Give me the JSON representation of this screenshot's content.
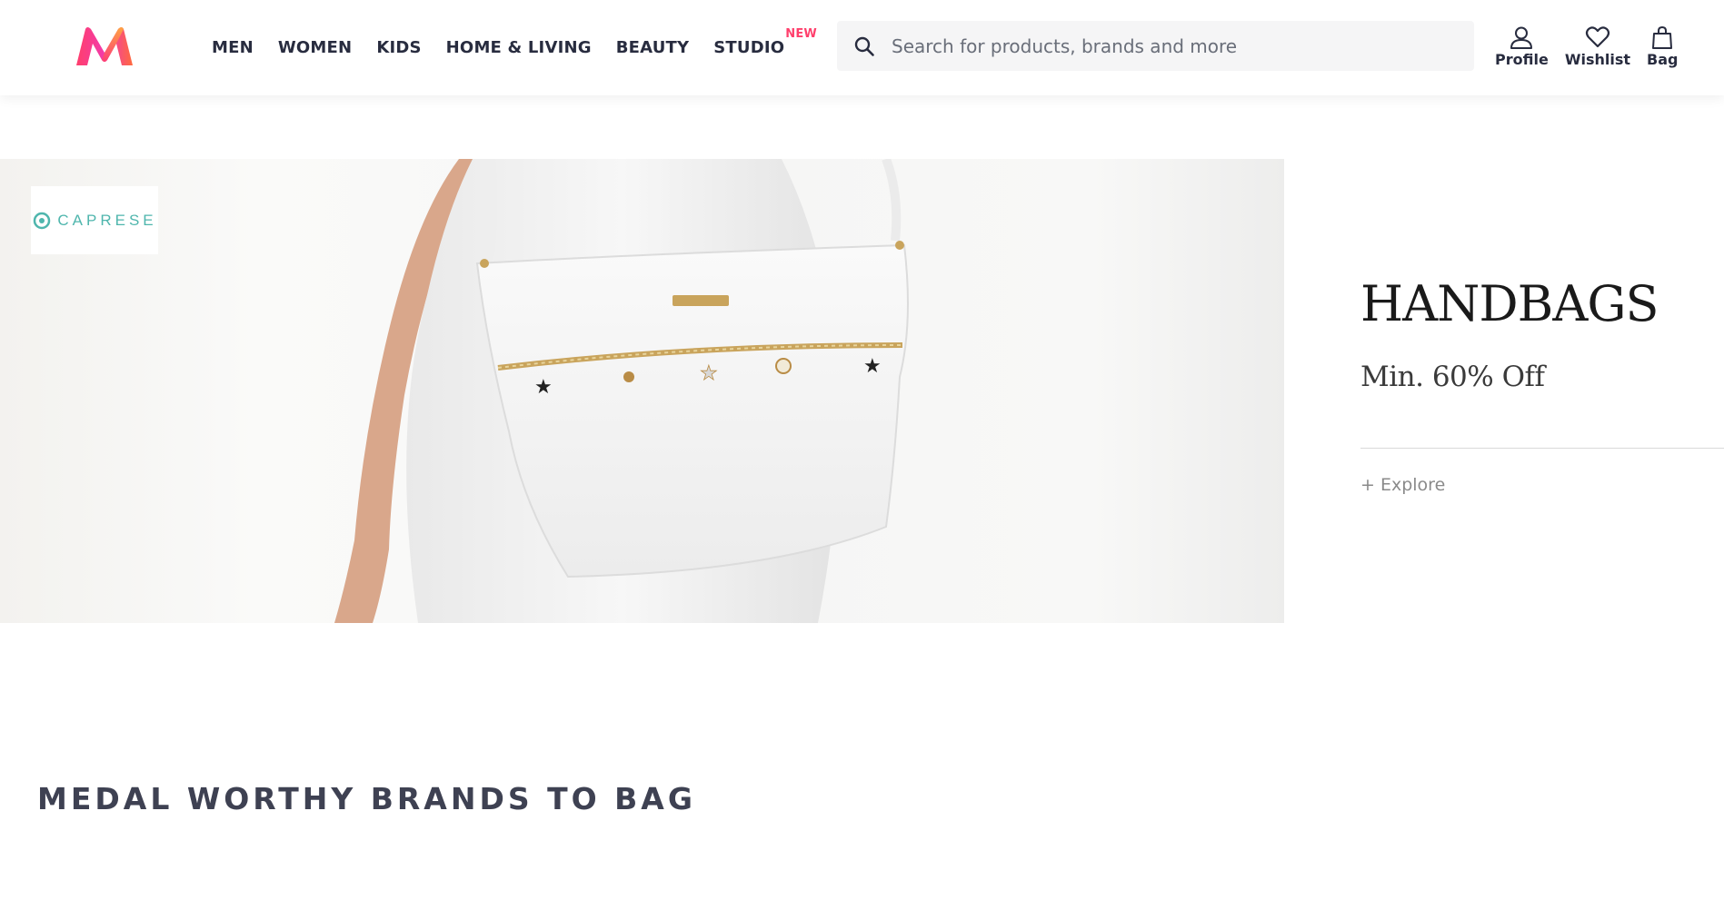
{
  "header": {
    "logo_icon": "myntra-logo-icon",
    "nav": [
      {
        "label": "MEN"
      },
      {
        "label": "WOMEN"
      },
      {
        "label": "KIDS"
      },
      {
        "label": "HOME & LIVING"
      },
      {
        "label": "BEAUTY"
      },
      {
        "label": "STUDIO",
        "badge": "NEW"
      }
    ],
    "search": {
      "placeholder": "Search for products, brands and more",
      "value": "",
      "icon": "search-icon"
    },
    "actions": [
      {
        "label": "Profile",
        "icon": "profile-icon"
      },
      {
        "label": "Wishlist",
        "icon": "heart-icon"
      },
      {
        "label": "Bag",
        "icon": "bag-icon"
      }
    ]
  },
  "banner": {
    "brand": "CAPRESE",
    "title": "HANDBAGS",
    "subtitle": "Min. 60% Off",
    "cta": "+ Explore"
  },
  "section": {
    "title": "MEDAL WORTHY BRANDS TO BAG"
  },
  "colors": {
    "accent": "#ff3f6c",
    "text": "#282c3f",
    "brand_teal": "#4fb6ad"
  }
}
